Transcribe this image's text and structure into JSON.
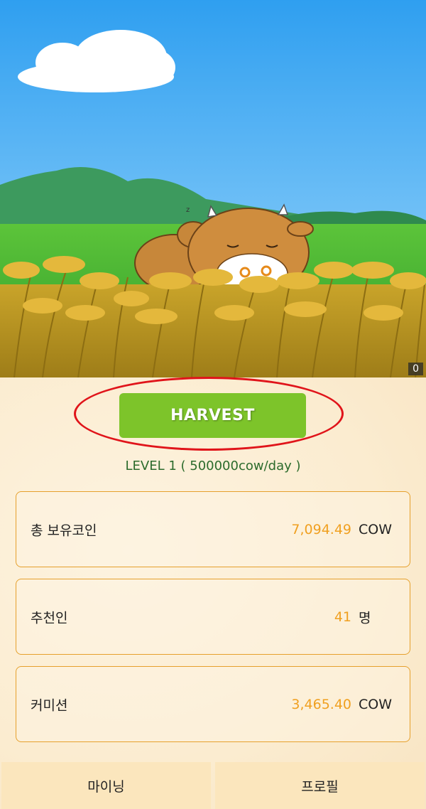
{
  "scene": {
    "counter": "0"
  },
  "harvest": {
    "label": "HARVEST"
  },
  "level": {
    "text": "LEVEL  1 ( 500000cow/day )"
  },
  "stats": [
    {
      "label": "총 보유코인",
      "value": "7,094.49",
      "unit": "COW"
    },
    {
      "label": "추천인",
      "value": "41",
      "unit": "명"
    },
    {
      "label": "커미션",
      "value": "3,465.40",
      "unit": "COW"
    }
  ],
  "tabs": [
    {
      "label": "마이닝"
    },
    {
      "label": "프로필"
    }
  ],
  "colors": {
    "accent_green": "#7dc42a",
    "highlight_ring": "#e0141a",
    "value_orange": "#f0a020",
    "card_border": "#e6a02c"
  }
}
